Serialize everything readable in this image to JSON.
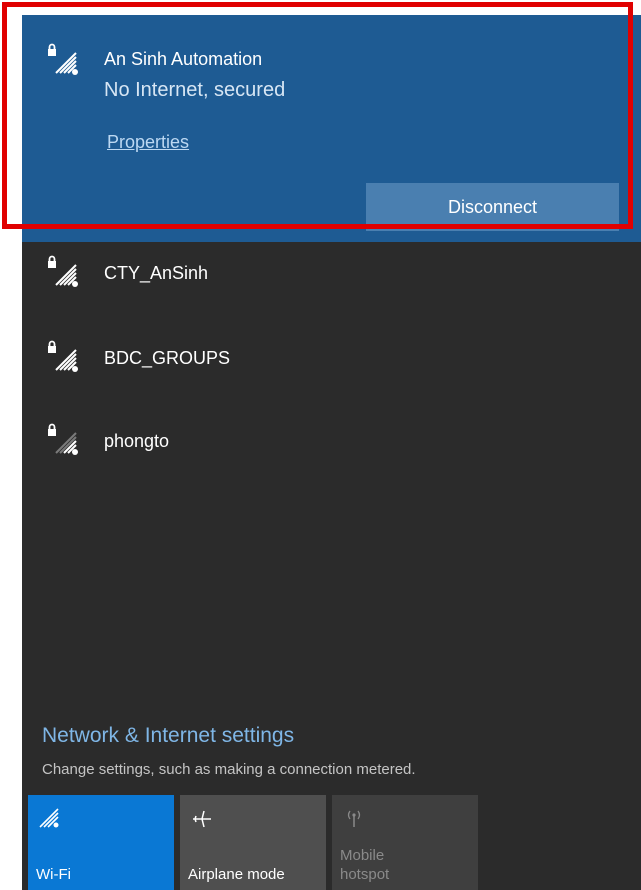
{
  "networks": {
    "connected": {
      "name": "An Sinh Automation",
      "status": "No Internet, secured",
      "properties_label": "Properties",
      "disconnect_label": "Disconnect"
    },
    "others": [
      {
        "name": "CTY_AnSinh",
        "icon": "wifi-secured-icon"
      },
      {
        "name": "BDC_GROUPS",
        "icon": "wifi-secured-icon"
      },
      {
        "name": "phongto",
        "icon": "wifi-secured-weak-icon"
      }
    ]
  },
  "settings": {
    "title": "Network & Internet settings",
    "description": "Change settings, such as making a connection metered."
  },
  "quick_actions": [
    {
      "label": "Wi-Fi",
      "icon": "wifi-icon",
      "active": true
    },
    {
      "label": "Airplane mode",
      "icon": "airplane-icon",
      "active": false
    },
    {
      "label_line1": "Mobile",
      "label_line2": "hotspot",
      "icon": "hotspot-icon",
      "active": false,
      "disabled": true
    }
  ],
  "colors": {
    "flyout_bg": "#2b2b2b",
    "selected_bg": "#1e5b93",
    "accent": "#0a78d4",
    "highlight_border": "#e00000"
  }
}
